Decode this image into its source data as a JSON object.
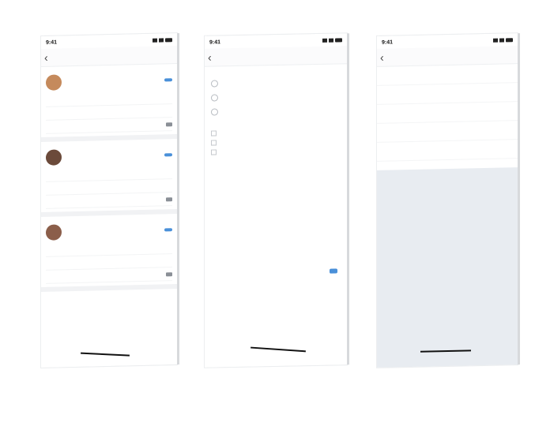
{
  "status": {
    "time": "9:41"
  },
  "screen1": {
    "title": "",
    "cards": [
      {
        "name": "",
        "sub": "",
        "badge": "",
        "rows": [
          "",
          "",
          ""
        ],
        "avatar_color": "#c58a5c"
      },
      {
        "name": "",
        "sub": "",
        "badge": "",
        "rows": [
          "",
          "",
          ""
        ],
        "avatar_color": "#6b4a3a"
      },
      {
        "name": "",
        "sub": "",
        "badge": "",
        "rows": [
          "",
          "",
          ""
        ],
        "avatar_color": "#8b5e4a"
      }
    ]
  },
  "screen2": {
    "title": "",
    "question": "",
    "options": [
      "",
      "",
      ""
    ],
    "note_label": "",
    "checks": [
      "",
      "",
      ""
    ]
  },
  "screen3": {
    "title": "",
    "items": [
      "",
      "",
      "",
      "",
      ""
    ]
  },
  "colors": {
    "accent": "#4a90d9",
    "panel_gray": "#e8ecf1"
  }
}
